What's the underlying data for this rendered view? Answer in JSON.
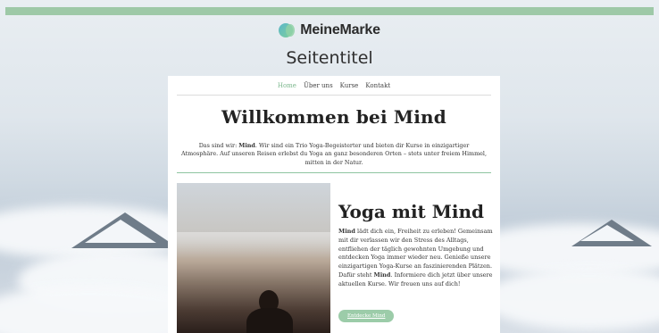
{
  "brand": {
    "name": "MeineMarke",
    "logo_icon": "brand-logo-icon"
  },
  "site_title": "Seitentitel",
  "nav": {
    "items": [
      "Home",
      "Über uns",
      "Kurse",
      "Kontakt"
    ],
    "active_index": 0
  },
  "welcome": {
    "heading": "Willkommen bei Mind",
    "intro_prefix": "Das sind wir: ",
    "intro_brand": "Mind",
    "intro_rest": ". Wir sind ein Trio Yoga-Begeisterter und bieten dir Kurse in einzigartiger Atmosphäre. Auf unseren Reisen erlebst du Yoga an ganz besonderen Orten – stets unter freiem Himmel, mitten in der Natur."
  },
  "feature": {
    "title": "Yoga mit Mind",
    "body_brand1": "Mind",
    "body_part1": " lädt dich ein, Freiheit zu erleben! Gemeinsam mit dir verlassen wir den Stress des Alltags, entfliehen der täglich gewohnten Umgebung und entdecken Yoga immer wieder neu. Genieße unsere einzigartigen Yoga-Kurse an faszinierenden Plätzen. Dafür steht ",
    "body_brand2": "Mind",
    "body_part2": ". Informiere dich jetzt über unsere aktuellen Kurse. Wir freuen uns auf dich!",
    "cta_label": "Entdecke Mind"
  },
  "colors": {
    "accent": "#9ec9a7",
    "nav_active": "#7db88e"
  }
}
